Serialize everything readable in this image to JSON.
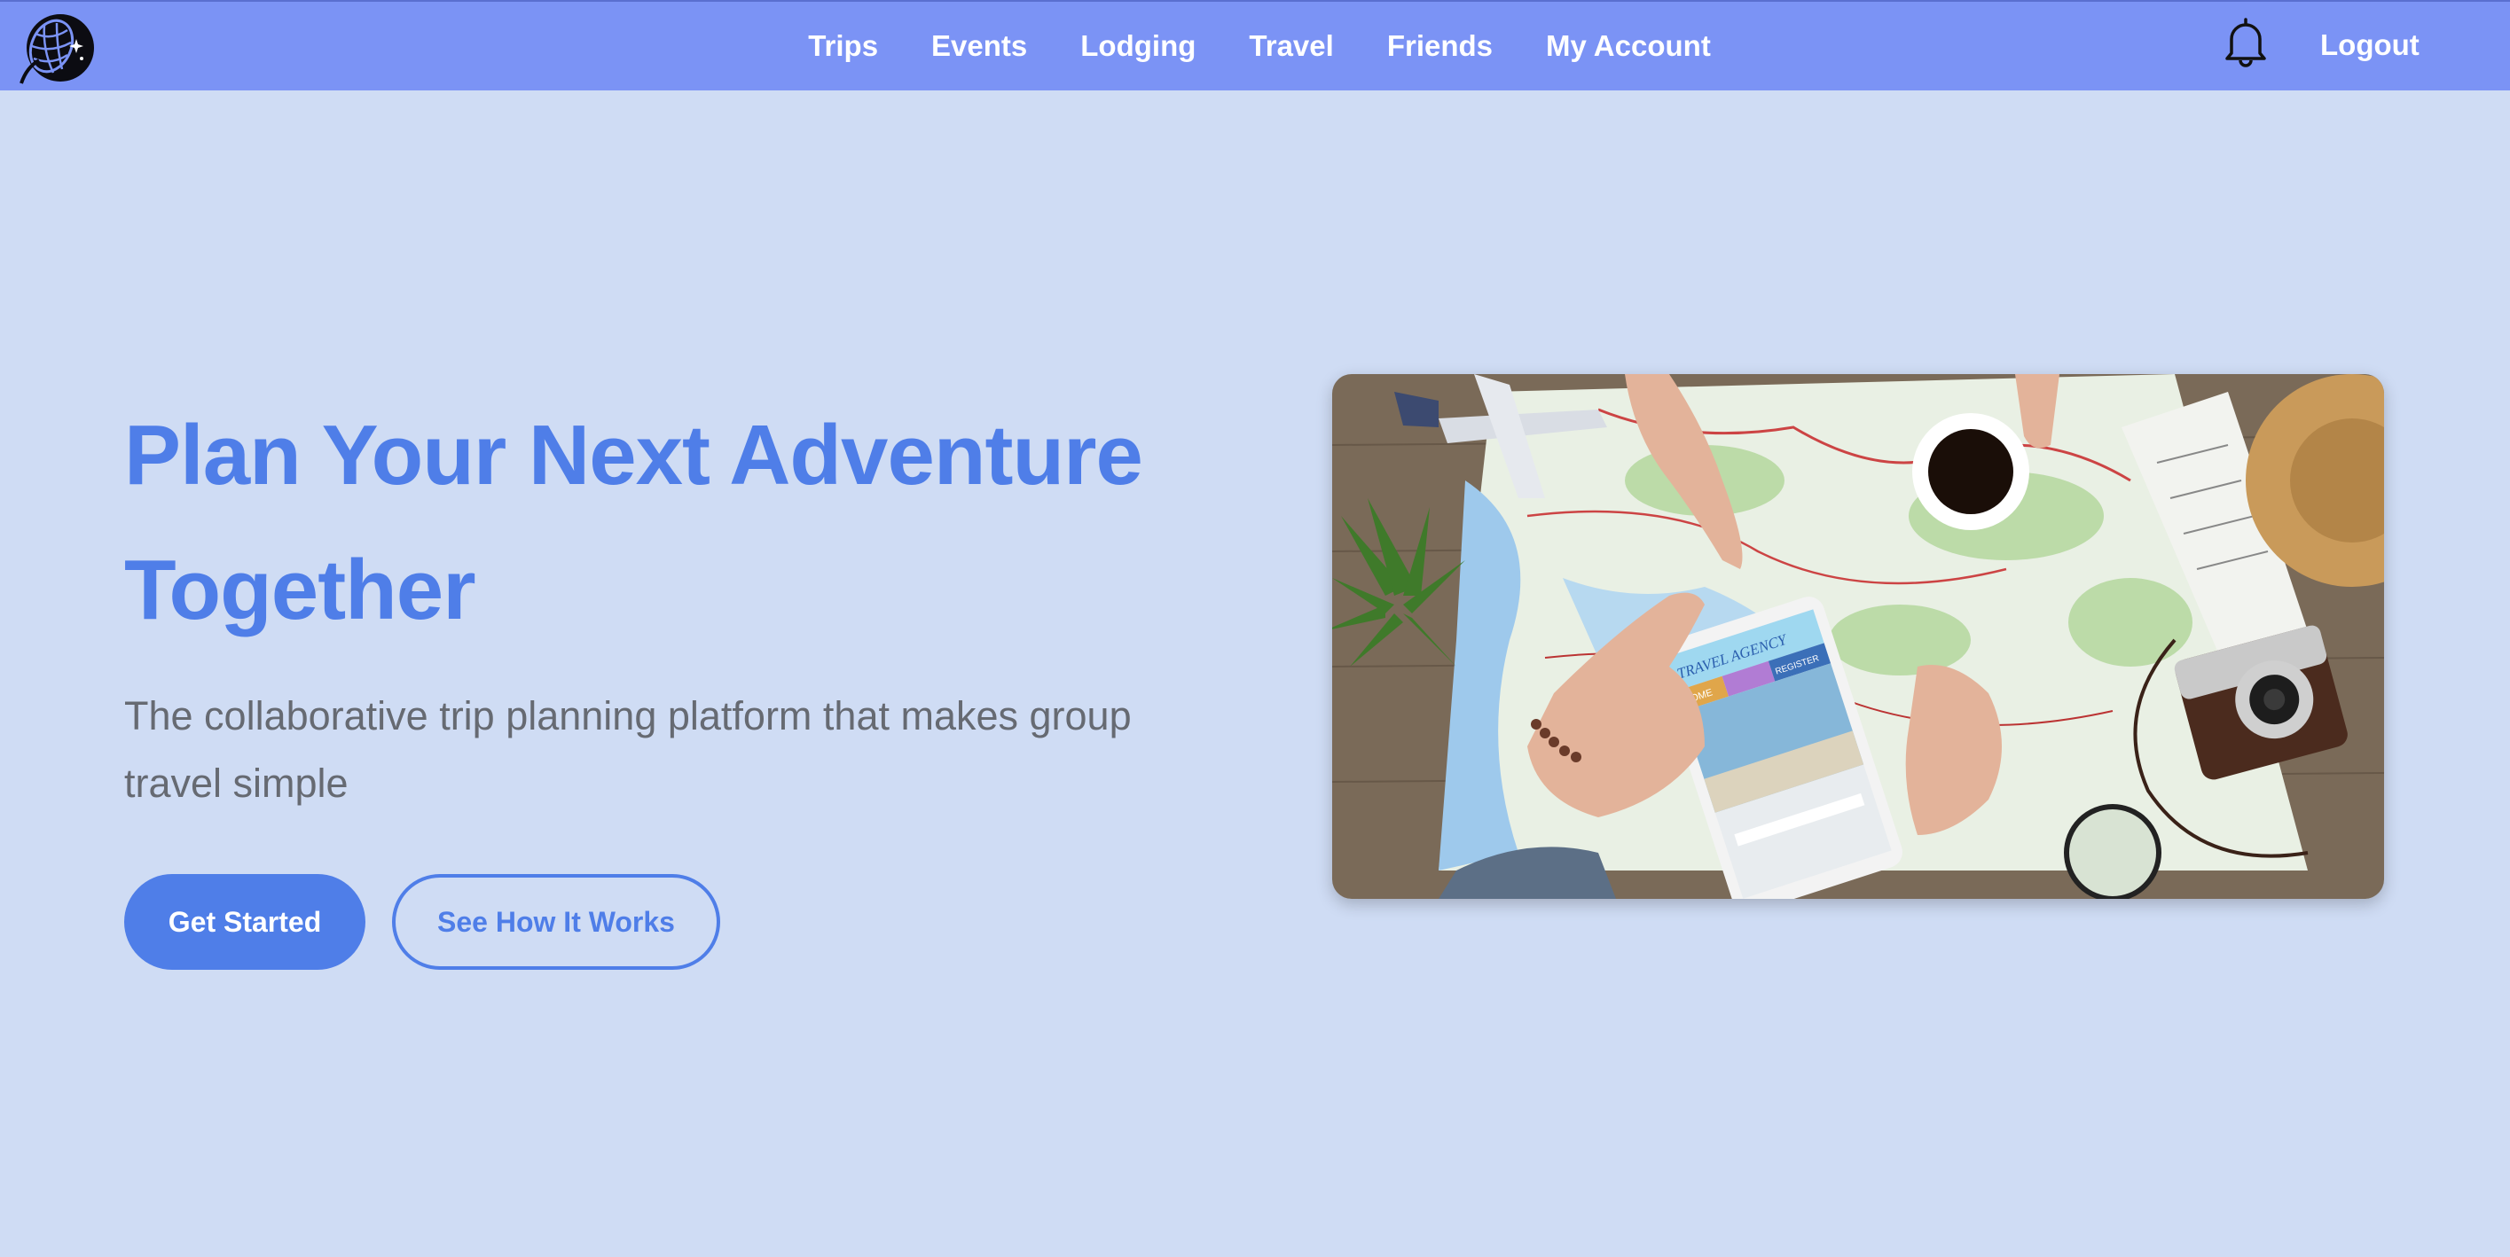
{
  "nav": {
    "logo_icon": "globe-rocket-logo",
    "links": [
      {
        "label": "Trips"
      },
      {
        "label": "Events"
      },
      {
        "label": "Lodging"
      },
      {
        "label": "Travel"
      },
      {
        "label": "Friends"
      },
      {
        "label": "My Account"
      }
    ],
    "bell_icon": "bell-icon",
    "logout_label": "Logout"
  },
  "hero": {
    "title_line1": "Plan Your Next Adventure",
    "title_line2": "Together",
    "subtitle": "The collaborative trip planning platform that makes group travel simple",
    "primary_button": "Get Started",
    "secondary_button": "See How It Works",
    "image_tablet_text": "TRAVEL AGENCY",
    "image_tablet_tabs": [
      "HOME",
      "REGISTER"
    ]
  },
  "colors": {
    "navbar": "#7b93f5",
    "background": "#cfdcf4",
    "accent": "#4f7ee8",
    "subtitle": "#666a72"
  }
}
